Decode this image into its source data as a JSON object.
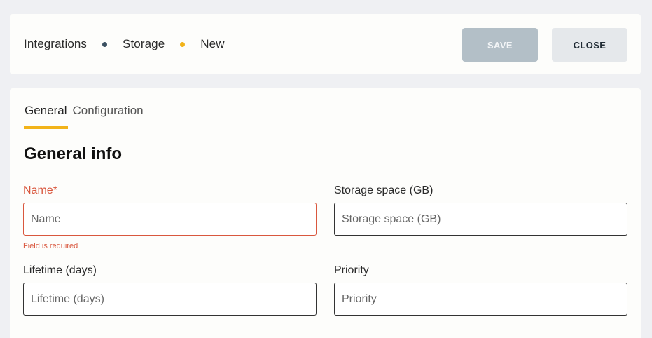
{
  "breadcrumb": {
    "items": [
      "Integrations",
      "Storage",
      "New"
    ]
  },
  "toolbar": {
    "save_label": "SAVE",
    "close_label": "CLOSE"
  },
  "tabs": [
    {
      "label": "General",
      "active": true
    },
    {
      "label": "Configuration",
      "active": false
    }
  ],
  "section": {
    "title": "General info"
  },
  "fields": {
    "name": {
      "label": "Name*",
      "placeholder": "Name",
      "value": "",
      "error": "Field is required"
    },
    "storage": {
      "label": "Storage space (GB)",
      "placeholder": "Storage space (GB)",
      "value": ""
    },
    "lifetime": {
      "label": "Lifetime (days)",
      "placeholder": "Lifetime (days)",
      "value": ""
    },
    "priority": {
      "label": "Priority",
      "placeholder": "Priority",
      "value": ""
    }
  },
  "colors": {
    "accent": "#f2b319",
    "error": "#d9573e",
    "save_disabled": "#b3bfc7",
    "breadcrumb_dot_dark": "#3b5061"
  }
}
